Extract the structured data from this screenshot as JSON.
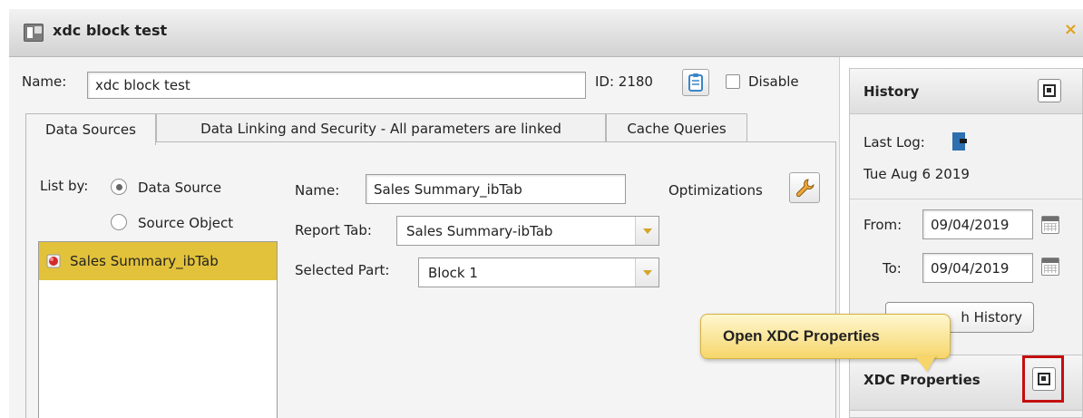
{
  "window": {
    "title": "xdc block test",
    "close_symbol": "×"
  },
  "header": {
    "name_label": "Name:",
    "name_value": "xdc block test",
    "id_text": "ID: 2180",
    "disable_label": "Disable"
  },
  "tabs": [
    {
      "label": "Data Sources",
      "active": true
    },
    {
      "label": "Data Linking and Security - All parameters are linked",
      "active": false
    },
    {
      "label": "Cache Queries",
      "active": false
    }
  ],
  "data_sources": {
    "list_by_label": "List by:",
    "options": [
      "Data Source",
      "Source Object"
    ],
    "selected_option": "Data Source",
    "items": [
      "Sales Summary_ibTab"
    ]
  },
  "detail": {
    "name_label": "Name:",
    "name_value": "Sales Summary_ibTab",
    "optimizations_label": "Optimizations",
    "report_tab_label": "Report Tab:",
    "report_tab_value": "Sales Summary-ibTab",
    "selected_part_label": "Selected Part:",
    "selected_part_value": "Block 1"
  },
  "history": {
    "title": "History",
    "last_log_label": "Last Log:",
    "last_log_date": "Tue Aug 6 2019",
    "from_label": "From:",
    "from_value": "09/04/2019",
    "to_label": "To:",
    "to_value": "09/04/2019",
    "search_button_visible_text": "h History"
  },
  "xdc_properties": {
    "title": "XDC Properties"
  },
  "callout": {
    "text": "Open XDC Properties"
  },
  "colors": {
    "selected_item": "#e2c23a",
    "callout_fill": "#f6d66b",
    "highlight_border": "#c40f0f",
    "close_accent": "#e0a31c"
  }
}
